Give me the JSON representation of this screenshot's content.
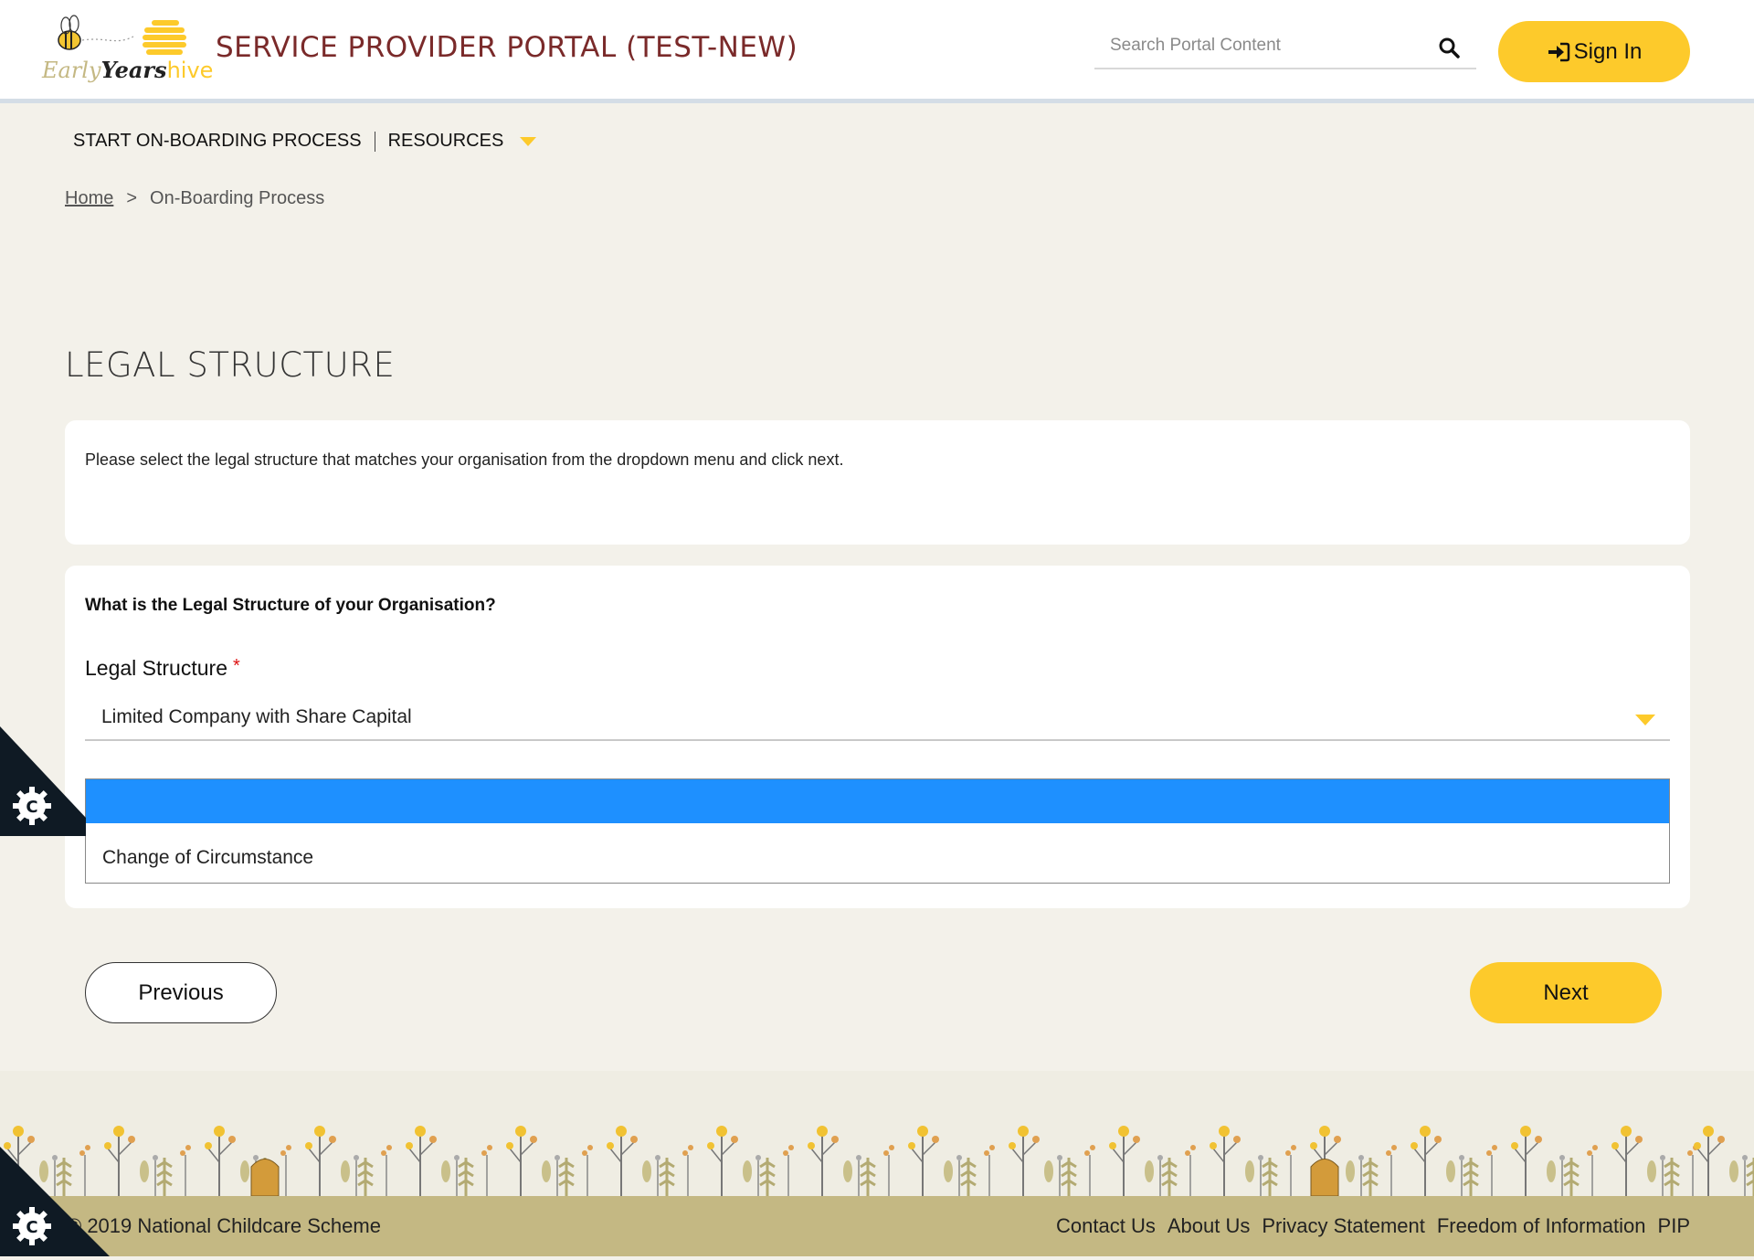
{
  "header": {
    "logo": {
      "line1": "Early",
      "line2": "Years",
      "line3": "hive"
    },
    "site_title": "SERVICE PROVIDER PORTAL (TEST-NEW)",
    "search_placeholder": "Search Portal Content",
    "signin_label": "Sign In"
  },
  "nav": {
    "items": [
      {
        "label": "START ON-BOARDING PROCESS"
      },
      {
        "label": "RESOURCES"
      }
    ]
  },
  "breadcrumb": {
    "home": "Home",
    "separator": ">",
    "current": "On-Boarding Process"
  },
  "page": {
    "title": "LEGAL STRUCTURE",
    "instructions": "Please select the legal structure that matches your organisation from the dropdown menu and click next.",
    "question": "What is the Legal Structure of your Organisation?",
    "field_label": "Legal Structure",
    "required_marker": "*",
    "selected_value": "Limited Company with Share Capital",
    "dropdown_options": [
      "",
      "Change of Circumstance"
    ]
  },
  "buttons": {
    "previous": "Previous",
    "next": "Next"
  },
  "footer": {
    "copyright": "© 2019 National Childcare Scheme",
    "links": [
      "Contact Us",
      "About Us",
      "Privacy Statement",
      "Freedom of Information",
      "PIP"
    ]
  },
  "colors": {
    "accent": "#fdca2b",
    "title": "#7a2a2a",
    "highlight": "#1e90ff",
    "footer": "#c4b883"
  },
  "icons": {
    "search": "search-icon",
    "signin": "sign-in-icon",
    "cookie": "cookie-settings-icon"
  }
}
